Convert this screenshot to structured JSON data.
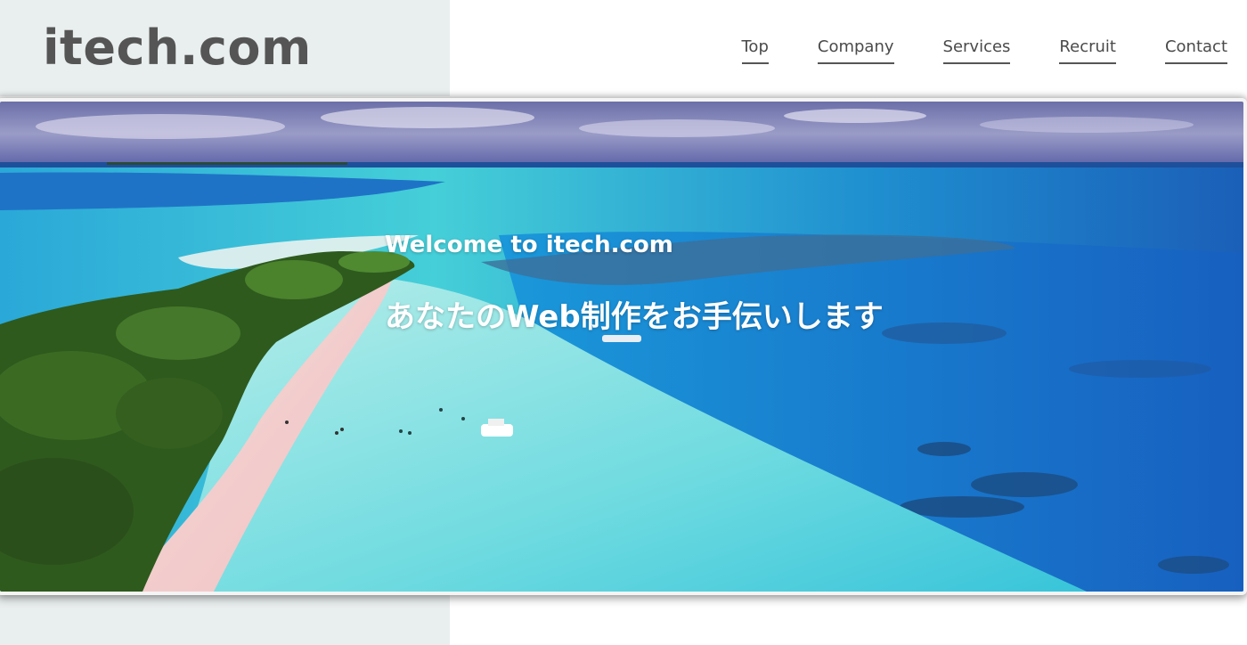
{
  "site": {
    "logo": "itech.com"
  },
  "nav": {
    "items": [
      {
        "label": "Top"
      },
      {
        "label": "Company"
      },
      {
        "label": "Services"
      },
      {
        "label": "Recruit"
      },
      {
        "label": "Contact"
      }
    ]
  },
  "hero": {
    "title": "Welcome to itech.com",
    "subtitle": "あなたのWeb制作をお手伝いします",
    "image": "tropical-beach-aerial-photo"
  },
  "colors": {
    "panel": "#e9eeee",
    "logo_text": "#555555",
    "nav_text": "#4a4a4a",
    "hero_text": "#ffffff"
  }
}
